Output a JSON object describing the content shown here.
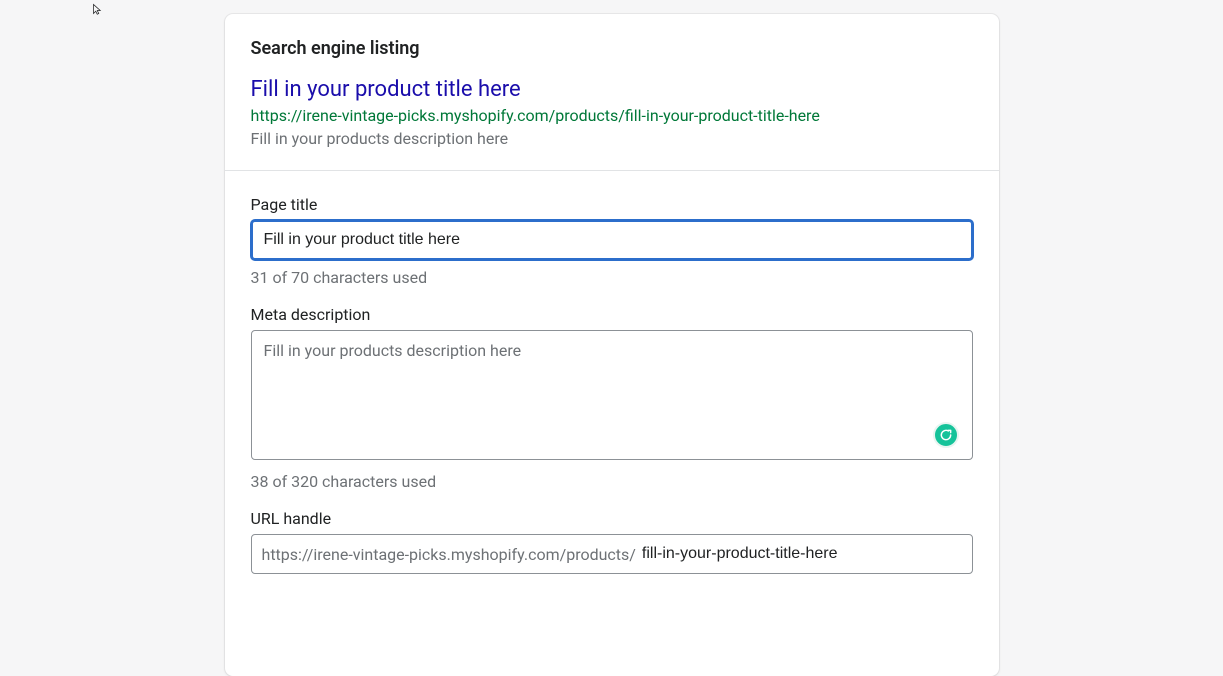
{
  "section": {
    "title": "Search engine listing"
  },
  "preview": {
    "title": "Fill in your product title here",
    "url": "https://irene-vintage-picks.myshopify.com/products/fill-in-your-product-title-here",
    "description": "Fill in your products description here"
  },
  "form": {
    "page_title": {
      "label": "Page title",
      "value": "Fill in your product title here",
      "helper": "31 of 70 characters used"
    },
    "meta_description": {
      "label": "Meta description",
      "placeholder": "Fill in your products description here",
      "helper": "38 of 320 characters used"
    },
    "url_handle": {
      "label": "URL handle",
      "prefix": "https://irene-vintage-picks.myshopify.com/products/",
      "value": "fill-in-your-product-title-here"
    }
  }
}
